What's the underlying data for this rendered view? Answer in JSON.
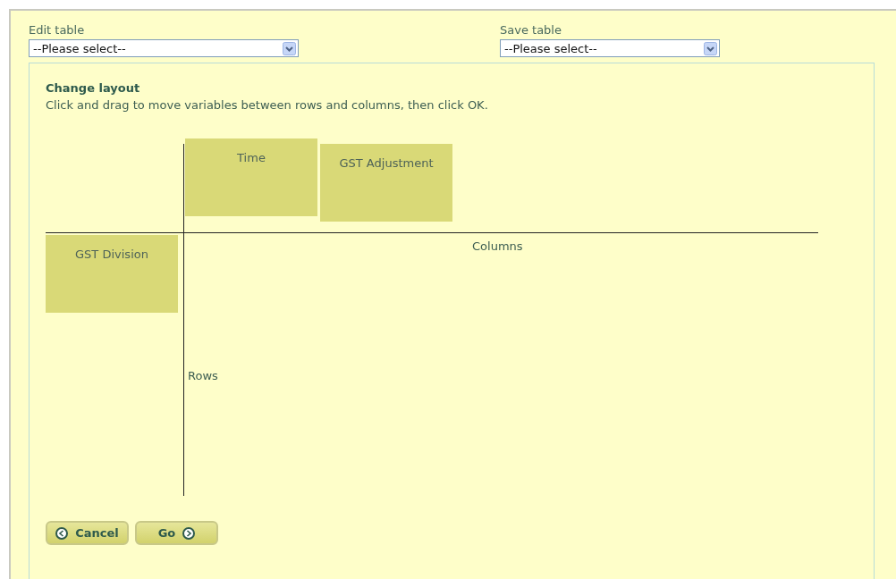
{
  "selectors": [
    {
      "label": "Edit table",
      "value": "--Please select--"
    },
    {
      "label": "Save table",
      "value": "--Please select--"
    }
  ],
  "panel": {
    "title": "Change layout",
    "instructions": "Click and drag to move variables between rows and columns, then click OK.",
    "column_variables": [
      "Time",
      "GST Adjustment"
    ],
    "row_variables": [
      "GST Division"
    ],
    "columns_label": "Columns",
    "rows_label": "Rows"
  },
  "buttons": [
    {
      "label": "Cancel",
      "kind": "back"
    },
    {
      "label": "Go",
      "kind": "forward"
    }
  ]
}
